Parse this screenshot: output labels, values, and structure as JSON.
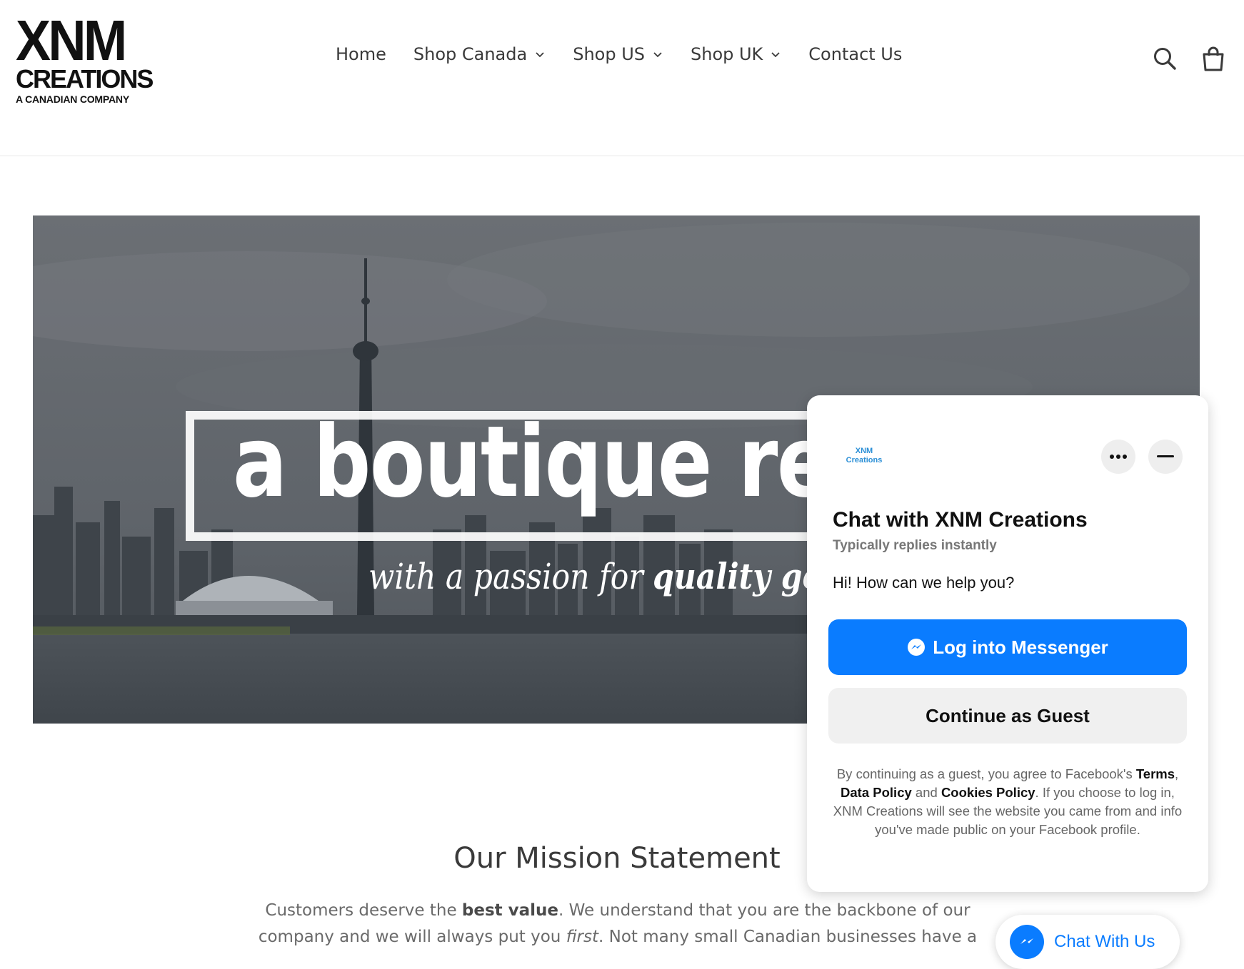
{
  "header": {
    "logo": {
      "line1": "XNM",
      "line2": "CREATIONS",
      "line3": "A CANADIAN COMPANY"
    },
    "nav": [
      {
        "label": "Home",
        "dropdown": false
      },
      {
        "label": "Shop Canada",
        "dropdown": true
      },
      {
        "label": "Shop US",
        "dropdown": true
      },
      {
        "label": "Shop UK",
        "dropdown": true
      },
      {
        "label": "Contact Us",
        "dropdown": false
      }
    ],
    "icons": [
      "search-icon",
      "cart-icon"
    ]
  },
  "hero": {
    "title": "a boutique ret",
    "subtitle_regular": "with a passion for ",
    "subtitle_bold": "quality go"
  },
  "mission": {
    "title": "Our Mission Statement",
    "p1_a": "Customers deserve the ",
    "p1_b": "best value",
    "p1_c": ".  We understand that you are the backbone of our company and we will always put you ",
    "p1_d": "first",
    "p1_e": ".  Not many small Canadian businesses have a"
  },
  "chat": {
    "brand_line1": "XNM",
    "brand_line2": "Creations",
    "title": "Chat with XNM Creations",
    "subtitle": "Typically replies instantly",
    "message": "Hi! How can we help you?",
    "login_label": "Log into Messenger",
    "guest_label": "Continue as Guest",
    "legal": {
      "t1": "By continuing as a guest, you agree to Facebook's ",
      "terms": "Terms",
      "t2": ", ",
      "data_policy": "Data Policy",
      "t3": " and ",
      "cookies": "Cookies Policy",
      "t4": ". If you choose to log in, XNM Creations will see the website you came from and info you've made public on your Facebook profile."
    }
  },
  "chat_pill": {
    "label": "Chat With Us"
  },
  "colors": {
    "messenger_blue": "#0a7cff",
    "text": "#3a3a3a"
  }
}
